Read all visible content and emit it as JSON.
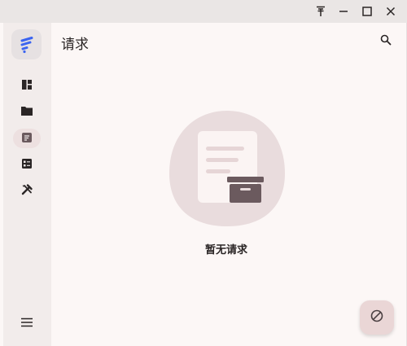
{
  "header": {
    "title": "请求"
  },
  "empty_state": {
    "message": "暂无请求"
  },
  "sidebar": {
    "items": [
      {
        "icon": "dashboard-icon"
      },
      {
        "icon": "folder-icon"
      },
      {
        "icon": "requests-icon",
        "active": true
      },
      {
        "icon": "list-icon"
      },
      {
        "icon": "tools-icon"
      }
    ],
    "menu_icon": "menu-icon"
  },
  "colors": {
    "accent": "#6b5a5e",
    "logo": "#3b64f0",
    "background": "#fcf7f6",
    "sidebar": "#f2eceb",
    "fab": "#ead6d6"
  }
}
